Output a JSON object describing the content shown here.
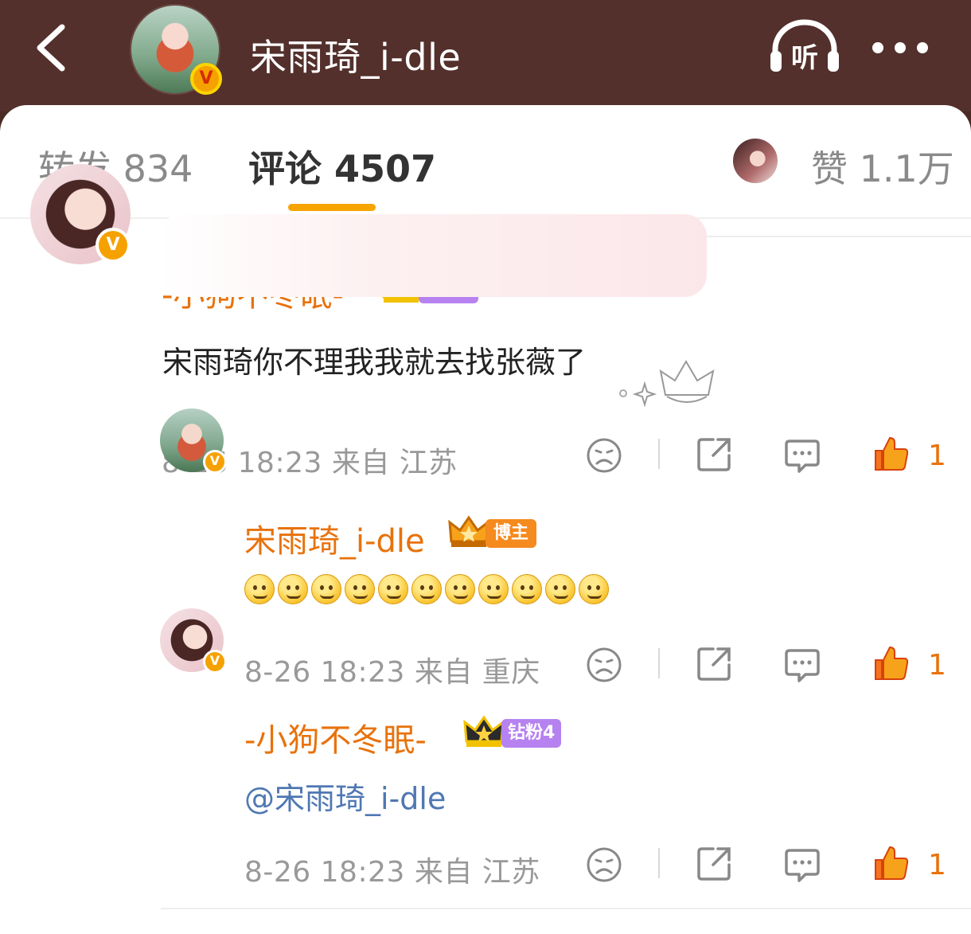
{
  "header": {
    "title": "宋雨琦_i-dle",
    "listen_label": "听",
    "avatar_badge": "V"
  },
  "tabs": {
    "repost": "转发 834",
    "comment": "评论 4507",
    "likes": "赞 1.1万"
  },
  "comments": [
    {
      "username": "-小狗不冬眠-",
      "fan_badge": "钻粉4",
      "badge_letter": "V",
      "text": "宋雨琦你不理我我就去找张薇了",
      "meta": "8-26 18:23  来自 江苏",
      "likes": "1"
    },
    {
      "username": "宋雨琦_i-dle",
      "host_badge": "博主",
      "badge_letter": "V",
      "emoji_count_shown": 11,
      "meta": "8-26 18:23  来自 重庆",
      "likes": "1"
    },
    {
      "username": "-小狗不冬眠-",
      "fan_badge": "钻粉4",
      "badge_letter": "V",
      "text": "@宋雨琦_i-dle",
      "meta": "8-26 18:23  来自 江苏",
      "likes": "1"
    }
  ],
  "colors": {
    "header_bg": "#53302c",
    "accent_orange": "#e8720c",
    "tab_underline": "#f7a400",
    "fan_badge": "#b682f0",
    "mention": "#4f78b3"
  },
  "icons": [
    "back-icon",
    "listen-icon",
    "more-icon",
    "dislike-icon",
    "share-icon",
    "reply-icon",
    "like-icon",
    "crown-icon"
  ]
}
